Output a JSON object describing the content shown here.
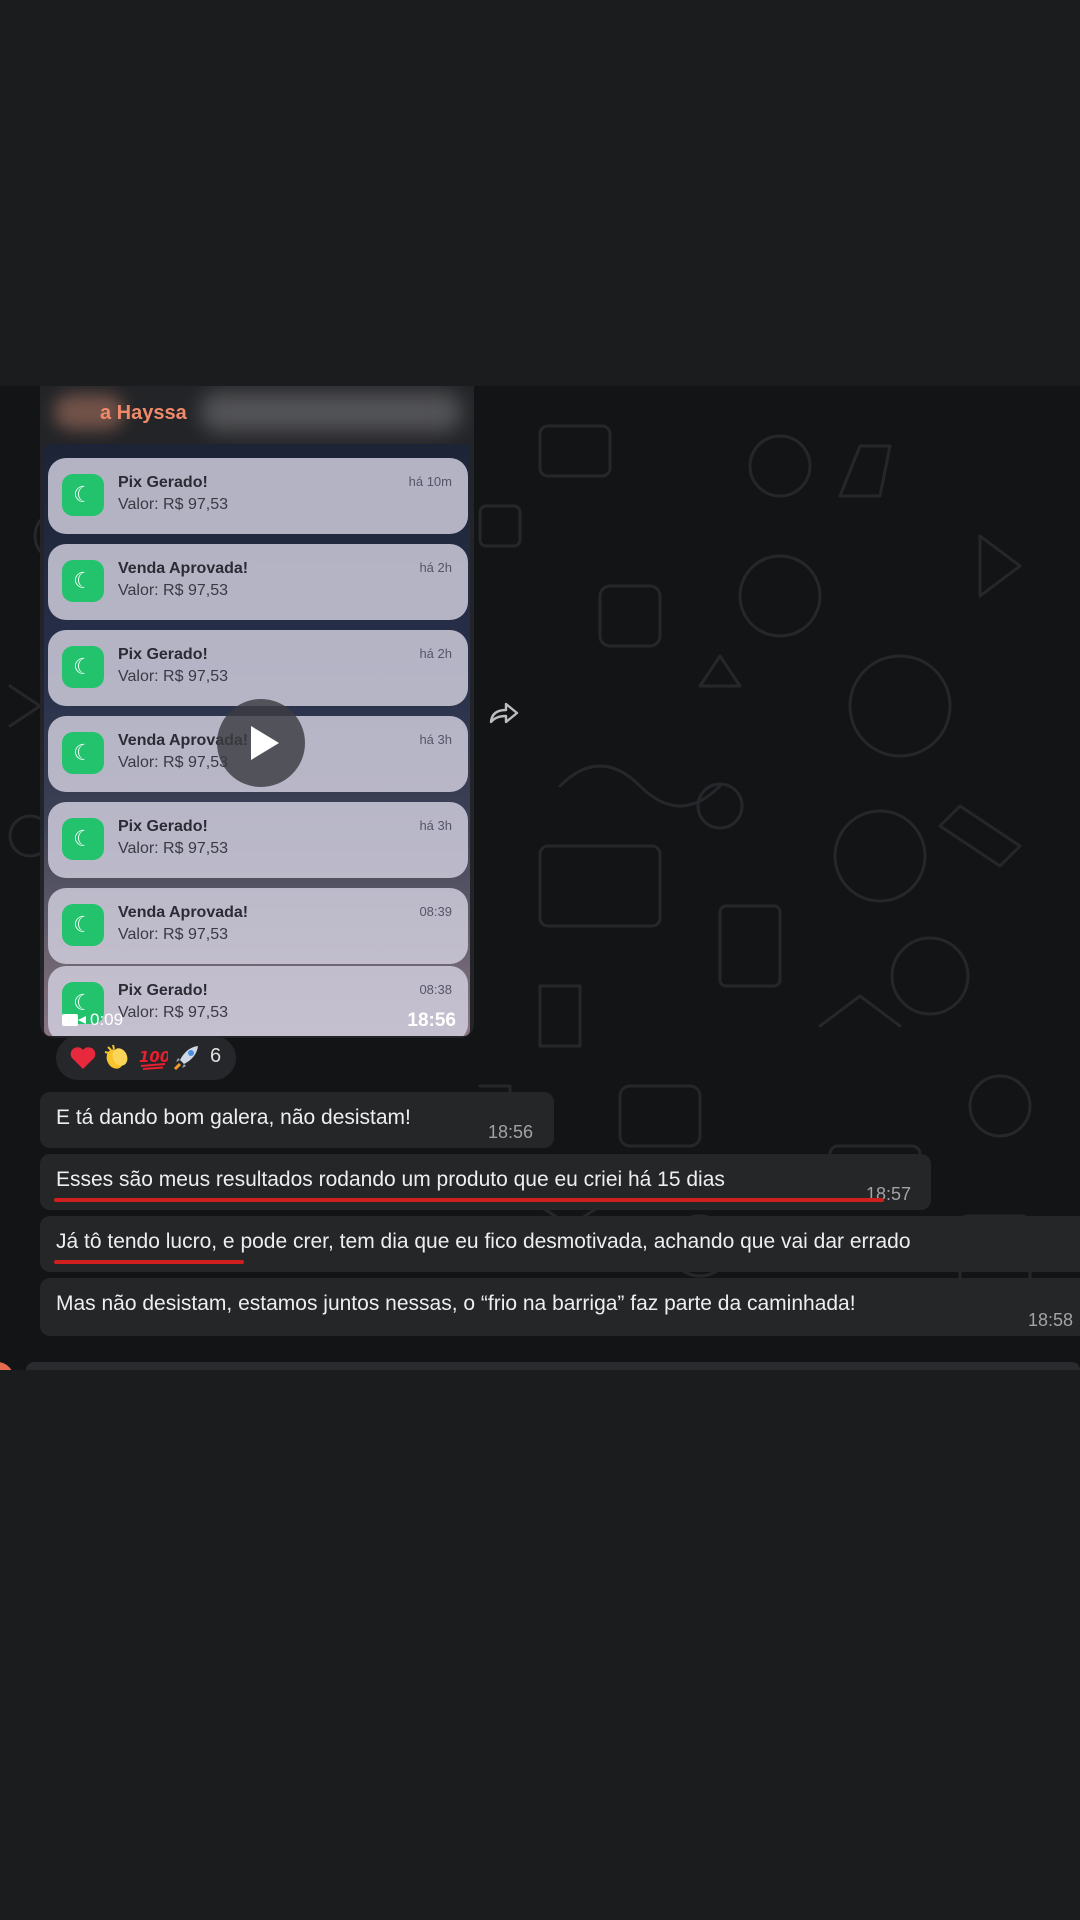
{
  "video_message": {
    "sender_name": "a Hayssa",
    "duration": "0:09",
    "time": "18:56",
    "notifications": [
      {
        "title": "Pix Gerado!",
        "value": "Valor: R$ 97,53",
        "time": "há 10m"
      },
      {
        "title": "Venda Aprovada!",
        "value": "Valor: R$ 97,53",
        "time": "há 2h"
      },
      {
        "title": "Pix Gerado!",
        "value": "Valor: R$ 97,53",
        "time": "há 2h"
      },
      {
        "title": "Venda Aprovada!",
        "value": "Valor: R$ 97,53",
        "time": "há 3h"
      },
      {
        "title": "Pix Gerado!",
        "value": "Valor: R$ 97,53",
        "time": "há 3h"
      },
      {
        "title": "Venda Aprovada!",
        "value": "Valor: R$ 97,53",
        "time": "08:39"
      },
      {
        "title": "Pix Gerado!",
        "value": "Valor: R$ 97,53",
        "time": "08:38"
      }
    ]
  },
  "reactions": {
    "emojis": [
      "heart-icon",
      "clapping-hands-icon",
      "hundred-points-icon",
      "rocket-icon"
    ],
    "count": "6"
  },
  "messages": [
    {
      "text": "E tá dando bom galera, não desistam!",
      "time": "18:56"
    },
    {
      "text": "Esses são meus resultados rodando um produto que eu criei há 15 dias",
      "time": "18:57"
    },
    {
      "text": "Já tô tendo lucro, e pode crer, tem dia que eu fico desmotivada, achando que vai dar errado",
      "time": ""
    },
    {
      "text": "Mas não desistam, estamos juntos nessas, o “frio na barriga” faz parte da caminhada!",
      "time": "18:58"
    }
  ],
  "colors": {
    "background": "#1b1c1e",
    "chat_background": "#131416",
    "bubble": "#252628",
    "sender_name": "#f0896a",
    "underline": "#d01f1f",
    "app_icon": "#22c36c"
  }
}
